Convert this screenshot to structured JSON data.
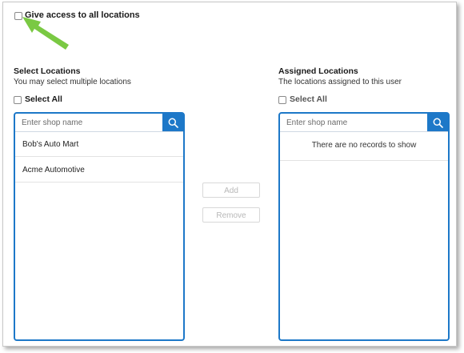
{
  "global_access": {
    "label": "Give access to all locations",
    "checked": false
  },
  "select_locations": {
    "title": "Select Locations",
    "subtitle": "You may select multiple locations",
    "select_all_label": "Select All",
    "search_placeholder": "Enter shop name",
    "items": [
      {
        "label": "Bob's Auto Mart"
      },
      {
        "label": "Acme Automotive"
      }
    ]
  },
  "assigned_locations": {
    "title": "Assigned Locations",
    "subtitle": "The locations assigned to this user",
    "select_all_label": "Select All",
    "search_placeholder": "Enter shop name",
    "empty_message": "There are no records to show"
  },
  "actions": {
    "add_label": "Add",
    "remove_label": "Remove"
  },
  "colors": {
    "accent": "#1d78c8",
    "callout_arrow": "#7ac943"
  }
}
